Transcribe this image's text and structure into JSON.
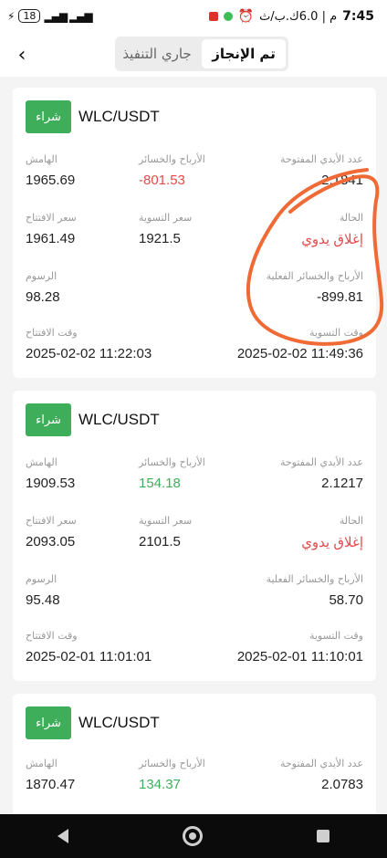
{
  "status_bar": {
    "time": "7:45",
    "left_indicator": "م | 6.0ك.ب/ث",
    "battery": "18"
  },
  "header": {
    "back_icon": "chevron-left-icon",
    "tabs": [
      {
        "label": "تم الإنجاز",
        "active": true
      },
      {
        "label": "جاري التنفيذ",
        "active": false
      }
    ]
  },
  "labels": {
    "margin": "الهامش",
    "pnl": "الأرباح والخسائر",
    "open_hands": "عدد الأيدي المفتوحة",
    "open_price": "سعر الافتتاح",
    "settle_price": "سعر التسوية",
    "status": "الحالة",
    "fees": "الرسوم",
    "actual_pnl": "الأرباح والخسائر الفعلية",
    "open_time": "وقت الافتتاح",
    "settle_time": "وقت التسوية"
  },
  "orders": [
    {
      "side": "شراء",
      "pair": "WLC/USDT",
      "margin": "1965.69",
      "pnl": "-801.53",
      "open_hands": "2.1841",
      "open_price": "1961.49",
      "settle_price": "1921.5",
      "status": "إغلاق يدوي",
      "fees": "98.28",
      "actual_pnl": "-899.81",
      "open_time": "2025-02-02 11:22:03",
      "settle_time": "2025-02-02 11:49:36"
    },
    {
      "side": "شراء",
      "pair": "WLC/USDT",
      "margin": "1909.53",
      "pnl": "154.18",
      "open_hands": "2.1217",
      "open_price": "2093.05",
      "settle_price": "2101.5",
      "status": "إغلاق يدوي",
      "fees": "95.48",
      "actual_pnl": "58.70",
      "open_time": "2025-02-01 11:01:01",
      "settle_time": "2025-02-01 11:10:01"
    },
    {
      "side": "شراء",
      "pair": "WLC/USDT",
      "margin": "1870.47",
      "pnl": "134.37",
      "open_hands": "2.0783"
    }
  ],
  "colors": {
    "buy": "#3fae5b",
    "loss": "#e24b4b",
    "profit": "#3fae5b",
    "annotation": "#f06a35"
  }
}
